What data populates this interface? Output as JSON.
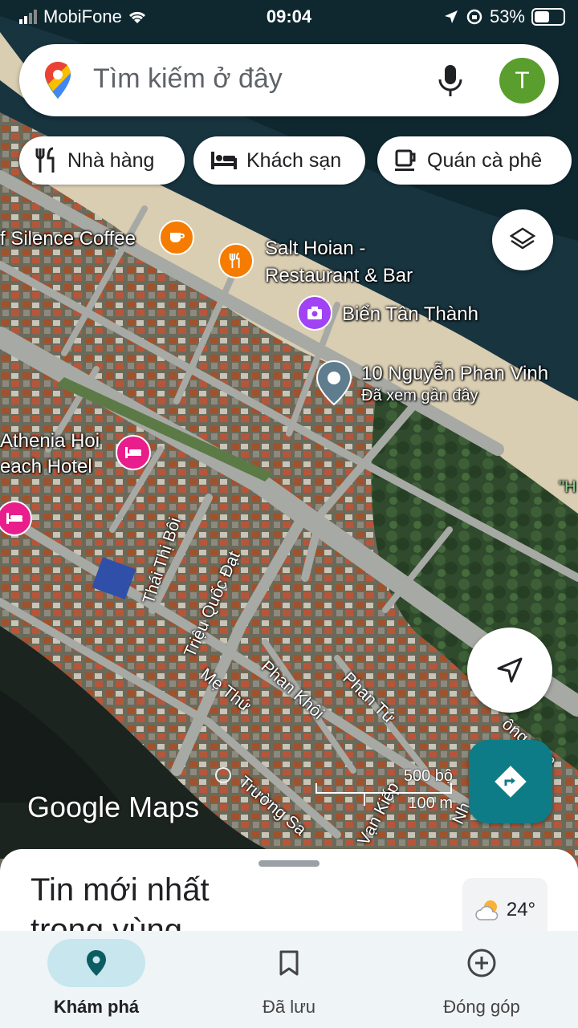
{
  "status_bar": {
    "carrier": "MobiFone",
    "time": "09:04",
    "battery": "53%",
    "battery_level": 0.53
  },
  "search": {
    "placeholder": "Tìm kiếm ở đây",
    "avatar_letter": "T"
  },
  "chips": [
    {
      "label": "Nhà hàng",
      "icon": "fork-knife-icon"
    },
    {
      "label": "Khách sạn",
      "icon": "bed-icon"
    },
    {
      "label": "Quán cà phê",
      "icon": "coffee-cup-icon"
    }
  ],
  "map": {
    "places": {
      "silence_coffee": "f Silence Coffee",
      "salt_hoian_1": "Salt Hoian -",
      "salt_hoian_2": "Restaurant & Bar",
      "bien_tan_thanh": "Biển Tân Thành",
      "saved_address": "10 Nguyễn Phan Vinh",
      "saved_note": "Đã xem gần đây",
      "athenia_1": "Athenia Hoi",
      "athenia_2": "each Hotel",
      "edge_label": "\"H"
    },
    "roads": {
      "thai_thi_boi": "Thái Thị Bôi",
      "trieu_quoc_dat": "Triệu Quốc Đạt",
      "me_thu": "Mẹ Thứ",
      "phan_khoi": "Phan Khôi",
      "phan_tu": "Phan Tứ",
      "truong_sa": "Trường Sa",
      "van_kiep": "Vạn Kiếp",
      "dong_qua": "ông Qua",
      "nh": "Nh"
    },
    "watermark": "Google Maps",
    "scale": {
      "imperial": "500 bộ",
      "metric": "100 m"
    }
  },
  "sheet": {
    "title": "Tin mới nhất trong vùng",
    "temperature": "24°"
  },
  "nav": [
    {
      "label": "Khám phá",
      "icon": "location-pin-icon",
      "active": true
    },
    {
      "label": "Đã lưu",
      "icon": "bookmark-icon",
      "active": false
    },
    {
      "label": "Đóng góp",
      "icon": "add-circle-icon",
      "active": false
    }
  ],
  "colors": {
    "accent": "#0e7c86",
    "coffee_poi": "#f57c00",
    "restaurant_poi": "#f57c00",
    "photo_poi": "#a142f4",
    "hotel_poi": "#e91e8c",
    "avatar": "#5a9e2d"
  }
}
